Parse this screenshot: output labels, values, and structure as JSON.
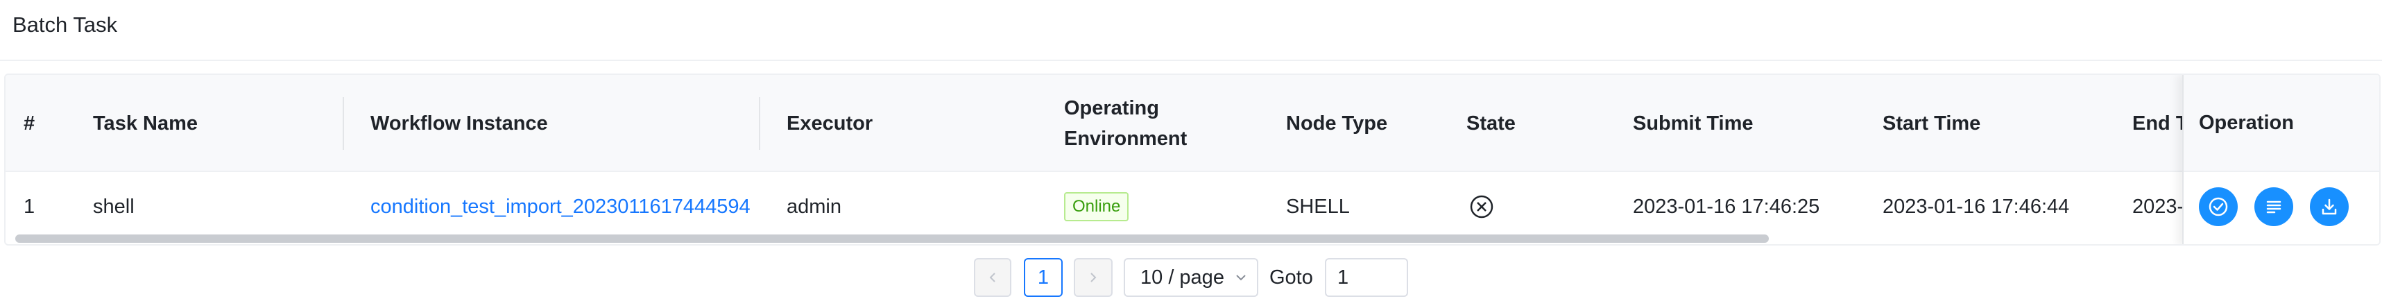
{
  "page": {
    "title": "Batch Task"
  },
  "table": {
    "headers": {
      "index": "#",
      "task_name": "Task Name",
      "workflow_instance": "Workflow Instance",
      "executor": "Executor",
      "operating_environment_line1": "Operating",
      "operating_environment_line2": "Environment",
      "node_type": "Node Type",
      "state": "State",
      "submit_time": "Submit Time",
      "start_time": "Start Time",
      "end_time": "End Ti",
      "operation": "Operation"
    },
    "rows": [
      {
        "index": "1",
        "task_name": "shell",
        "workflow_instance": "condition_test_import_20230116174459 4",
        "workflow_instance_text": "condition_test_import_2023011617444594",
        "executor": "admin",
        "operating_environment": "Online",
        "node_type": "SHELL",
        "state_icon": "circle-x-icon",
        "submit_time": "2023-01-16 17:46:25",
        "start_time": "2023-01-16 17:46:44",
        "end_time": "2023-"
      }
    ],
    "operations": [
      "check-circle-icon",
      "log-lines-icon",
      "download-icon"
    ]
  },
  "pagination": {
    "prev_icon": "chevron-left-icon",
    "current_page": "1",
    "next_icon": "chevron-right-icon",
    "page_size": "10 / page",
    "goto_label": "Goto",
    "goto_value": "1"
  },
  "colors": {
    "primary": "#1890ff",
    "link": "#1677ff",
    "tag_green": "#389e0d"
  }
}
